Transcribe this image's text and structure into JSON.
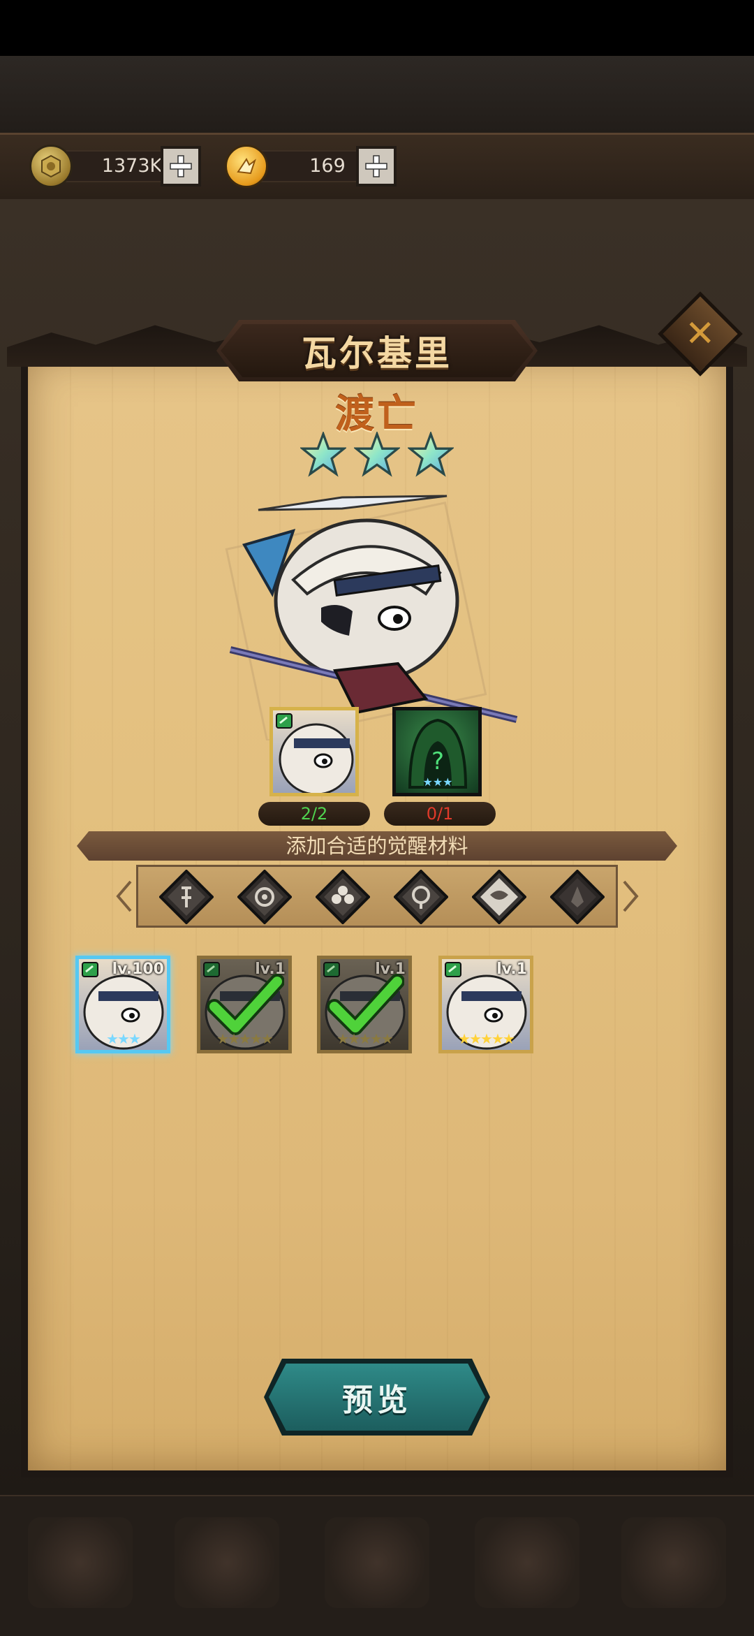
{
  "resources": [
    {
      "name": "gold",
      "value": "1373K",
      "add_label": "+"
    },
    {
      "name": "spirit",
      "value": "169",
      "add_label": "+"
    }
  ],
  "panel": {
    "title": "瓦尔基里",
    "hero_name": "渡亡",
    "hero_stars": 3,
    "close_label": "✕"
  },
  "materials": [
    {
      "name": "same-hero",
      "count": "2/2",
      "count_color": "#4fd24f"
    },
    {
      "name": "any-3-star",
      "count": "0/1",
      "count_color": "#e03a2a"
    }
  ],
  "banner_text": "添加合适的觉醒材料",
  "faction_filters": [
    "faction-1",
    "faction-2",
    "faction-3",
    "faction-4",
    "faction-5",
    "faction-6"
  ],
  "hero_cards": [
    {
      "level": "lv.100",
      "stars": "★★★",
      "state": "selected"
    },
    {
      "level": "lv.1",
      "stars": "★★★★★",
      "state": "used"
    },
    {
      "level": "lv.1",
      "stars": "★★★★★",
      "state": "used"
    },
    {
      "level": "lv.1",
      "stars": "★★★★★",
      "state": "available"
    }
  ],
  "preview_label": "预览",
  "colors": {
    "accent": "#1c5e5e",
    "parchment": "#e3c07f",
    "selected": "#56c8f2"
  }
}
